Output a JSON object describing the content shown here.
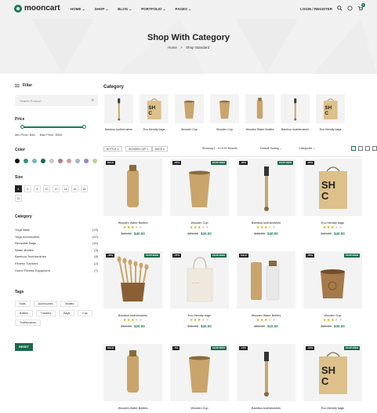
{
  "header": {
    "logo": "mooncart",
    "nav": [
      "HOME ⌄",
      "SHOP ⌄",
      "BLOG ⌄",
      "PORTFOLIO ⌄",
      "PAGES ⌄"
    ],
    "login": "LOGIN / REGISTER",
    "cart_count": "0"
  },
  "hero": {
    "title": "Shop With Category",
    "breadcrumb_home": "Home",
    "breadcrumb_sep": ">",
    "breadcrumb_current": "Shop Standard"
  },
  "sidebar": {
    "filter_label": "Filter",
    "search_placeholder": "Search Product",
    "price_heading": "Price",
    "min_price": "Min Price: $46",
    "max_price": "Max Price: $346",
    "color_heading": "Color",
    "colors": [
      "#111111",
      "#2f8f8a",
      "#7fb3c8",
      "#1a6a4a",
      "#c9c9c9",
      "#b07a8c",
      "#d39aa0",
      "#a9b3c4",
      "#9a86c8",
      "#b8d29a"
    ],
    "size_heading": "Size",
    "sizes": [
      "4",
      "6",
      "8",
      "10",
      "12",
      "14",
      "16",
      "18",
      "20"
    ],
    "category_heading": "Category",
    "categories": [
      {
        "name": "Yoga Mats",
        "count": "(13)"
      },
      {
        "name": "Yoga Accessories",
        "count": "(22)"
      },
      {
        "name": "Reusable Bags",
        "count": "(10)"
      },
      {
        "name": "Water Bottles",
        "count": "(3)"
      },
      {
        "name": "Bamboo Toothbrushes",
        "count": "(8)"
      },
      {
        "name": "Fitness Trackers",
        "count": "(2)"
      },
      {
        "name": "Home Fitness Equipment",
        "count": "(7)"
      }
    ],
    "tags_heading": "Tags",
    "tags": [
      "Mats",
      "Accessories",
      "Bottles",
      "Bottles",
      "Trackers",
      "Bags",
      "Cup",
      "Toothbrushes"
    ],
    "reset_label": "RESET"
  },
  "category_strip": {
    "heading": "Category",
    "items": [
      "Bamboo toothbrushes",
      "Eco friendly bags",
      "Wooden Cup",
      "Wooden Cup",
      "Wooden Water Bottles",
      "Bamboo toothbrushes",
      "Eco friendly bags"
    ]
  },
  "toolbar": {
    "chips": [
      "BOTTLE ✕",
      "WOODEN CUP ✕",
      "BAGS ✕"
    ],
    "showing": "Showing 1 - 9 Of 94 Results",
    "sorting": "Default Sorting ⌄",
    "categories": "Categories ⌄"
  },
  "products": [
    {
      "name": "Wooden Water Bottles",
      "badge": "SALE",
      "featured": "",
      "rating": 3,
      "old": "$48.00",
      "new": "$40.00",
      "img": "bottle"
    },
    {
      "name": "Wooden Cup",
      "badge": "-20%",
      "featured": "FEATURED",
      "rating": 3,
      "old": "$30.00",
      "new": "$20.00",
      "img": "cup"
    },
    {
      "name": "Bamboo toothbrushes",
      "badge": "-30%",
      "featured": "FEATURED",
      "rating": 3,
      "old": "$45.00",
      "new": "$40.00",
      "img": "brush"
    },
    {
      "name": "Eco friendly bags",
      "badge": "-25%",
      "featured": "",
      "rating": 3,
      "old": "$48.00",
      "new": "$40.00",
      "img": "bag"
    },
    {
      "name": "Bamboo toothbrushes",
      "badge": "-45%",
      "featured": "FEATURED",
      "rating": 3,
      "old": "$64.00",
      "new": "$20.00",
      "img": "brushcup"
    },
    {
      "name": "Eco friendly bags",
      "badge": "-37%",
      "featured": "FEATURED",
      "rating": 3,
      "old": "$45.00",
      "new": "$40.00",
      "img": "tote"
    },
    {
      "name": "Wooden Water Bottles",
      "badge": "SALE",
      "featured": "",
      "rating": 3,
      "old": "$25.00",
      "new": "$10.00",
      "img": "bottles2"
    },
    {
      "name": "Wooden Cup",
      "badge": "-35%",
      "featured": "FEATURED",
      "rating": 3,
      "old": "$80.00",
      "new": "$40.00",
      "img": "cup2"
    },
    {
      "name": "Wooden Water Bottles",
      "badge": "SALE",
      "featured": "",
      "rating": 0,
      "old": "",
      "new": "",
      "img": "bottle"
    },
    {
      "name": "Wooden Cup",
      "badge": "-5%",
      "featured": "FEATURED",
      "rating": 0,
      "old": "",
      "new": "",
      "img": "cup"
    },
    {
      "name": "Bamboo toothbrushes",
      "badge": "-11%",
      "featured": "",
      "rating": 0,
      "old": "",
      "new": "",
      "img": "brush"
    },
    {
      "name": "Eco friendly bags",
      "badge": "-19%",
      "featured": "FEATURED",
      "rating": 0,
      "old": "",
      "new": "",
      "img": "bag"
    }
  ]
}
